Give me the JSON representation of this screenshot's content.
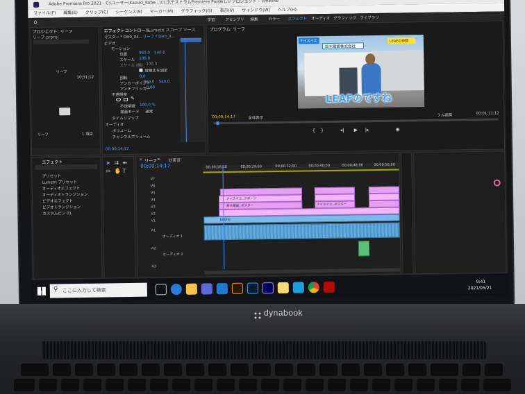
{
  "app": {
    "title": "Adobe Premiere Pro 2021 - C:\\ユーザー\\Kazuki_Kobe...\\ロゴ\\テストラムPremiere Pro\\新しいプロジェクト - Timeline",
    "menus": [
      "ファイル(F)",
      "編集(E)",
      "クリップ(C)",
      "シーケンス(S)",
      "マーカー(M)",
      "グラフィック(G)",
      "表示(V)",
      "ウィンドウ(W)",
      "ヘルプ(H)"
    ],
    "workspaces": [
      "学習",
      "アセンブリ",
      "編集",
      "カラー",
      "エフェクト",
      "オーディオ",
      "グラフィック",
      "ライブラリ"
    ]
  },
  "project_panel": {
    "title": "プロジェクト: リーフ",
    "tab": "リーフ.prproj",
    "bin_name": "リーフ",
    "bin_duration": "10;31;12",
    "item_name": "リーフ",
    "item_count": "1 項目"
  },
  "effects_panel": {
    "title": "エフェクト",
    "search_placeholder": "",
    "items": [
      "プリセット",
      "Lumetri プリセット",
      "オーディオエフェクト",
      "オーディオトランジション",
      "ビデオエフェクト",
      "ビデオトランジション",
      "カスタムビン 01"
    ]
  },
  "effect_controls": {
    "tabs": [
      "エフェクトコントロール",
      "Lumetri スコープ",
      "ソース"
    ],
    "master": "マスター * DH0_04...",
    "sequence": "リーフ * DH0_0...",
    "section_video": "ビデオ",
    "motion": "モーション",
    "position_label": "位置",
    "position_x": "960.0",
    "position_y": "540.0",
    "scale_label": "スケール",
    "scale_value": "100.0",
    "scale_width_label": "スケール (幅)",
    "scale_width_value": "100.0",
    "uniform_label": "縦横比を固定",
    "rotation_label": "回転",
    "rotation_value": "0.0",
    "anchor_label": "アンカーポイント",
    "anchor_x": "960.0",
    "anchor_y": "540.0",
    "flicker_label": "アンチフリッカー",
    "flicker_value": "0.00",
    "opacity_section": "不透明度",
    "opacity_label": "不透明度",
    "opacity_value": "100.0 %",
    "blend_label": "描画モード",
    "blend_value": "通常",
    "time_remap": "タイムリマップ",
    "section_audio": "オーディオ",
    "volume": "ボリューム",
    "channel_volume": "チャンネルボリューム",
    "timecode": "00;00;14;17"
  },
  "program_monitor": {
    "title": "プログラム: リーフ",
    "timecode": "00;00;14;17",
    "zoom": "全体表示",
    "quality": "フル画質",
    "duration": "00;01;11;12",
    "video_logo": "ナイスイエ",
    "video_company": "鈴木電設株式会社",
    "video_badge": "LEAFの仲間",
    "video_caption": "LEAFのですね"
  },
  "timeline": {
    "tab": "リーフ",
    "menu_icon": "≡",
    "tab2": "効果音",
    "timecode": "00;00;14;17",
    "ruler": [
      "00;00;16;00",
      "00;00;24;00",
      "00;00;32;00",
      "00;00;40;00",
      "00;00;48;00",
      "00;00;56;00"
    ],
    "video_tracks": [
      "V7",
      "V6",
      "V5",
      "V4",
      "V3",
      "V2",
      "V1"
    ],
    "audio_tracks": [
      "A1",
      "A2",
      "A3"
    ],
    "audio_label_1": "オーディオ 1",
    "audio_label_2": "オーディオ 2",
    "clip_labels": [
      "ナイスイエ..スポーツ",
      "鈴木電設..ポスター",
      "LEAFの",
      "ナイスイエ..ポスター"
    ]
  },
  "taskbar": {
    "search_placeholder": "ここに入力して検索",
    "time": "9:41",
    "date": "2021/05/21"
  },
  "laptop": {
    "brand": "dynabook"
  }
}
